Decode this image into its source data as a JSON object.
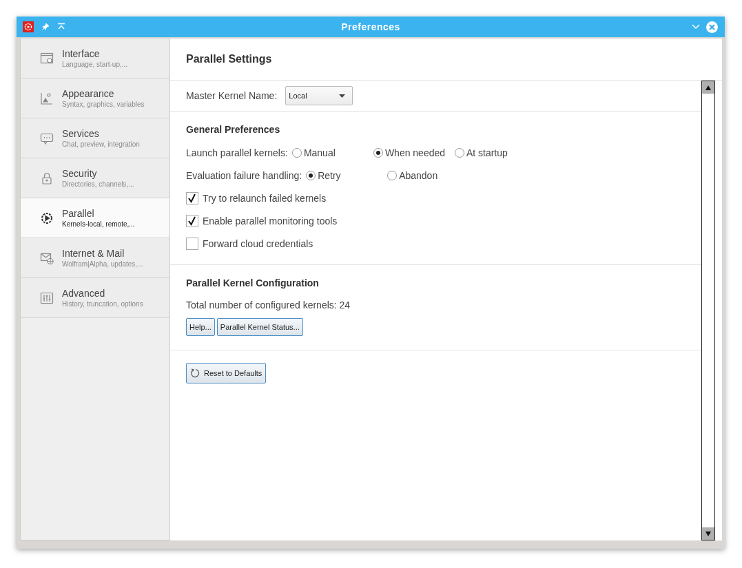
{
  "window": {
    "title": "Preferences"
  },
  "sidebar": {
    "items": [
      {
        "title": "Interface",
        "subtitle": "Language, start-up,...",
        "selected": false
      },
      {
        "title": "Appearance",
        "subtitle": "Syntax, graphics, variables",
        "selected": false
      },
      {
        "title": "Services",
        "subtitle": "Chat, preview, integration",
        "selected": false
      },
      {
        "title": "Security",
        "subtitle": "Directories, channels,...",
        "selected": false
      },
      {
        "title": "Parallel",
        "subtitle": "Kernels-local, remote,...",
        "selected": true
      },
      {
        "title": "Internet & Mail",
        "subtitle": "Wolfram|Alpha, updates,...",
        "selected": false
      },
      {
        "title": "Advanced",
        "subtitle": "History, truncation, options",
        "selected": false
      }
    ]
  },
  "page_title": "Parallel Settings",
  "master_kernel": {
    "label": "Master Kernel Name:",
    "value": "Local"
  },
  "general": {
    "heading": "General Preferences",
    "radio_groups": [
      {
        "label": "Launch parallel kernels:",
        "options": [
          {
            "label": "Manual",
            "selected": false
          },
          {
            "label": "When needed",
            "selected": true
          },
          {
            "label": "At startup",
            "selected": false
          }
        ]
      },
      {
        "label": "Evaluation failure handling:",
        "options": [
          {
            "label": "Retry",
            "selected": true
          },
          {
            "label": "Abandon",
            "selected": false
          }
        ]
      }
    ],
    "checkboxes": [
      {
        "label": "Try to relaunch failed kernels",
        "checked": true
      },
      {
        "label": "Enable parallel monitoring tools",
        "checked": true
      },
      {
        "label": "Forward cloud credentials",
        "checked": false
      }
    ]
  },
  "configuration": {
    "heading": "Parallel Kernel Configuration",
    "total": "Total number of configured kernels: 24",
    "buttons": [
      "Help...",
      "Parallel Kernel Status..."
    ]
  },
  "reset_button": "Reset to Defaults"
}
